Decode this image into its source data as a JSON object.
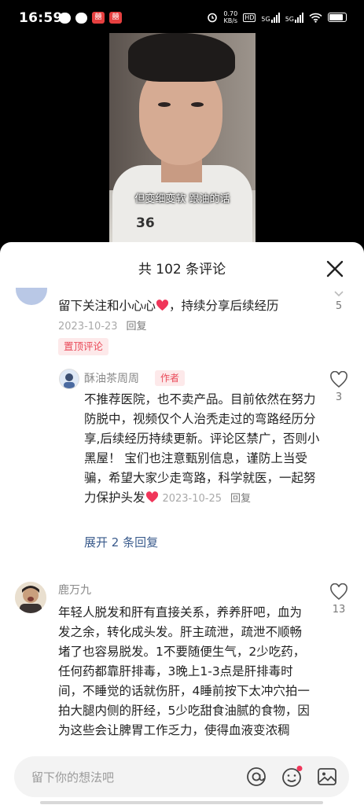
{
  "status_bar": {
    "time": "16:59",
    "net_speed": "0.70",
    "net_unit": "KB/s",
    "hd": "HD",
    "signal1": "5G",
    "signal2": "5G"
  },
  "video": {
    "caption": "但变细变软 跟油的话",
    "shirt_number": "36"
  },
  "comments_sheet": {
    "title": "共 102 条评论",
    "comments": [
      {
        "text": "留下关注和小心心",
        "text_tail": "，持续分享后续经历",
        "date": "2023-10-23",
        "reply_label": "回复",
        "badge": "置顶评论",
        "like_count": "5"
      }
    ],
    "author_reply": {
      "username": "酥油茶周周",
      "tag": "作者",
      "text": "不推荐医院，也不卖产品。目前依然在努力防脱中，视频仅个人治秃走过的弯路经历分享,后续经历持续更新。评论区禁广，否则小黑屋！ 宝们也注意甄别信息，谨防上当受骗，希望大家少走弯路，科学就医，一起努力保护头发",
      "date": "2023-10-25",
      "reply_label": "回复",
      "like_count": "3"
    },
    "expand_replies": "展开 2 条回复",
    "comment2": {
      "username": "鹿万九",
      "text": "年轻人脱发和肝有直接关系，养养肝吧，血为发之余，转化成头发。肝主疏泄，疏泄不顺畅堵了也容易脱发。1不要随便生气，2少吃药，任何药都靠肝排毒，3晚上1-3点是肝排毒时间，不睡觉的话就伤肝，4睡前按下太冲穴拍一拍大腿内侧的肝经，5少吃甜食油腻的食物，因为这些会让脾胃工作乏力，使得血液变浓稠",
      "like_count": "13"
    }
  },
  "input_bar": {
    "placeholder": "留下你的想法吧"
  },
  "icons": [
    "close-icon",
    "heart-icon",
    "at-icon",
    "emoji-icon",
    "image-icon"
  ],
  "colors": {
    "accent_red": "#e94a59",
    "link_blue": "#3a5b8c",
    "heart_red": "#f0365a"
  }
}
